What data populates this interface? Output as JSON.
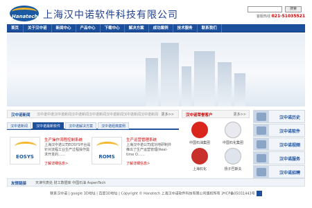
{
  "header": {
    "logo_text": "Hanatech",
    "company_name": "上海汉中诺软件科技有限公司",
    "search_button": "搜索",
    "hotline_label": "客服热线",
    "hotline_number": "021-51035521"
  },
  "nav": {
    "items": [
      "首页",
      "关于汉中诺",
      "新闻中心",
      "产品中心",
      "下载中心",
      "解决方案",
      "成功案例",
      "技术服务",
      "联系我们"
    ]
  },
  "news": {
    "title": "汉中诺新闻",
    "text": "汉中诺中诺汉中诺新闻汉中诺新闻汉中诺新闻汉中诺新闻汉中诺新闻汉中诺新闻",
    "more": "更多>>"
  },
  "tabs": [
    "汉中诺新闻",
    "汉中诺最新软件",
    "汉中诺解决方案",
    "汉中诺经典案例"
  ],
  "products": [
    {
      "logo": "EOSYS",
      "title": "生产操作流程控制系统",
      "desc": "上海汉中诺公司EOSYS平台是针对流程工业生产过程操作需求开发的……",
      "more": "了解详细信息>"
    },
    {
      "logo": "ROMS",
      "title": "生产运营管理系统",
      "desc": "上海汉中诺公司成功地研制并推出了生产运营管理(Real-time O……",
      "more": "了解详细信息>"
    }
  ],
  "customers": {
    "title": "汉中诺荣誉客户",
    "more": "更多>>",
    "items": [
      {
        "name": "中国石油集团",
        "color": "#d9251c"
      },
      {
        "name": "中国石化集团",
        "color": "#e8eaf0"
      },
      {
        "name": "上海石化",
        "color": "#c8302b"
      },
      {
        "name": "扬子巴斯夫",
        "color": "#e0e4ec"
      }
    ]
  },
  "sidebar": {
    "items": [
      "汉中诺历史",
      "汉中诺软件",
      "汉中诺视频",
      "汉中诺服务",
      "汉中诺招聘"
    ]
  },
  "links": {
    "title": "友情链接",
    "items": "天津代表处  财工数据库  中国石油  AspenTech"
  },
  "footer": {
    "text": "联系汉中诺 | google 3D地址 | 百度3D地址 | Copyright © Hanatech 上海汉中诺软件科技有限公司版权所有  沪ICP备05031443号"
  }
}
